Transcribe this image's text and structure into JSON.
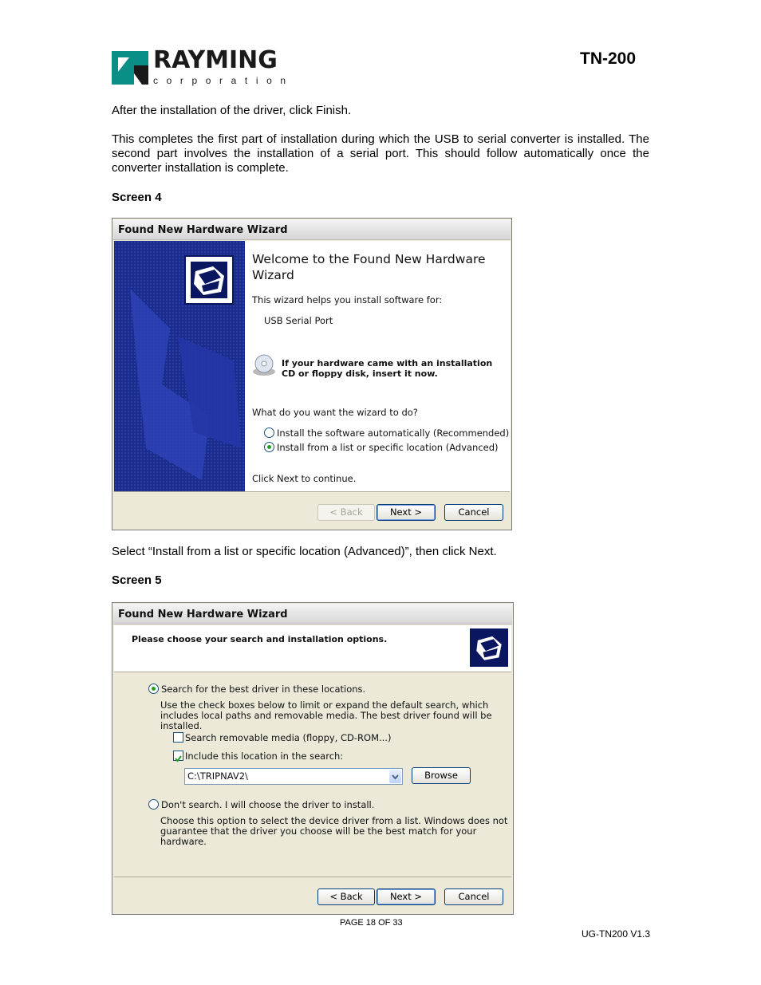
{
  "header": {
    "logo_word": "RAYMING",
    "logo_sub": "corporation",
    "doc_title": "TN-200"
  },
  "body": {
    "p1": "After the installation of the driver, click Finish.",
    "p2": "This completes the first part of installation during which the USB to serial converter is installed.  The second part involves the installation of a serial port.  This should follow automatically once the converter installation is complete.",
    "screen4_heading": "Screen 4",
    "p3": "Select “Install from a list or specific location (Advanced)”, then click Next.",
    "screen5_heading": "Screen 5"
  },
  "screen4": {
    "title": "Found New Hardware Wizard",
    "welcome": "Welcome to the Found New Hardware Wizard",
    "helps": "This wizard helps you install software for:",
    "device": "USB Serial Port",
    "cd_note": "If your hardware came with an installation CD or floppy disk, insert it now.",
    "question": "What do you want the wizard to do?",
    "options": [
      {
        "label": "Install the software automatically (Recommended)",
        "selected": false
      },
      {
        "label": "Install from a list or specific location (Advanced)",
        "selected": true
      }
    ],
    "continue": "Click Next to continue.",
    "buttons": {
      "back": "< Back",
      "next": "Next >",
      "cancel": "Cancel"
    }
  },
  "screen5": {
    "title": "Found New Hardware Wizard",
    "header": "Please choose your search and installation options.",
    "opt_search": "Search for the best driver in these locations.",
    "opt_search_desc": "Use the check boxes below to limit or expand the default search, which includes local paths and removable media. The best driver found will be installed.",
    "chk_removable": "Search removable media (floppy, CD-ROM...)",
    "chk_include": "Include this location in the search:",
    "path_value": "C:\\TRIPNAV2\\",
    "browse": "Browse",
    "opt_dont": "Don't search. I will choose the driver to install.",
    "opt_dont_desc": "Choose this option to select the device driver from a list.  Windows does not guarantee that the driver you choose will be the best match for your hardware.",
    "buttons": {
      "back": "< Back",
      "next": "Next >",
      "cancel": "Cancel"
    }
  },
  "footer": {
    "page": "PAGE 18 OF 33",
    "version": "UG-TN200 V1.3"
  },
  "colors": {
    "banner_blue": "#1b2d8c",
    "title_gray": "#d6d6d6",
    "radio_green": "#21a121"
  }
}
